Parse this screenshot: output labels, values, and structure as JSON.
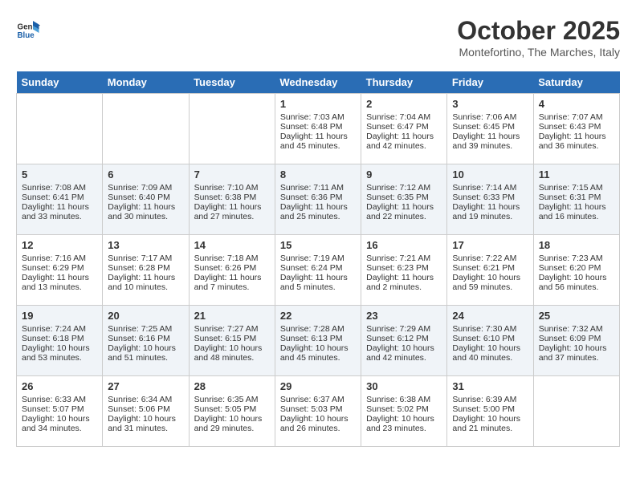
{
  "header": {
    "logo_line1": "General",
    "logo_line2": "Blue",
    "month": "October 2025",
    "location": "Montefortino, The Marches, Italy"
  },
  "days_of_week": [
    "Sunday",
    "Monday",
    "Tuesday",
    "Wednesday",
    "Thursday",
    "Friday",
    "Saturday"
  ],
  "weeks": [
    [
      {
        "day": "",
        "content": ""
      },
      {
        "day": "",
        "content": ""
      },
      {
        "day": "",
        "content": ""
      },
      {
        "day": "1",
        "content": "Sunrise: 7:03 AM\nSunset: 6:48 PM\nDaylight: 11 hours\nand 45 minutes."
      },
      {
        "day": "2",
        "content": "Sunrise: 7:04 AM\nSunset: 6:47 PM\nDaylight: 11 hours\nand 42 minutes."
      },
      {
        "day": "3",
        "content": "Sunrise: 7:06 AM\nSunset: 6:45 PM\nDaylight: 11 hours\nand 39 minutes."
      },
      {
        "day": "4",
        "content": "Sunrise: 7:07 AM\nSunset: 6:43 PM\nDaylight: 11 hours\nand 36 minutes."
      }
    ],
    [
      {
        "day": "5",
        "content": "Sunrise: 7:08 AM\nSunset: 6:41 PM\nDaylight: 11 hours\nand 33 minutes."
      },
      {
        "day": "6",
        "content": "Sunrise: 7:09 AM\nSunset: 6:40 PM\nDaylight: 11 hours\nand 30 minutes."
      },
      {
        "day": "7",
        "content": "Sunrise: 7:10 AM\nSunset: 6:38 PM\nDaylight: 11 hours\nand 27 minutes."
      },
      {
        "day": "8",
        "content": "Sunrise: 7:11 AM\nSunset: 6:36 PM\nDaylight: 11 hours\nand 25 minutes."
      },
      {
        "day": "9",
        "content": "Sunrise: 7:12 AM\nSunset: 6:35 PM\nDaylight: 11 hours\nand 22 minutes."
      },
      {
        "day": "10",
        "content": "Sunrise: 7:14 AM\nSunset: 6:33 PM\nDaylight: 11 hours\nand 19 minutes."
      },
      {
        "day": "11",
        "content": "Sunrise: 7:15 AM\nSunset: 6:31 PM\nDaylight: 11 hours\nand 16 minutes."
      }
    ],
    [
      {
        "day": "12",
        "content": "Sunrise: 7:16 AM\nSunset: 6:29 PM\nDaylight: 11 hours\nand 13 minutes."
      },
      {
        "day": "13",
        "content": "Sunrise: 7:17 AM\nSunset: 6:28 PM\nDaylight: 11 hours\nand 10 minutes."
      },
      {
        "day": "14",
        "content": "Sunrise: 7:18 AM\nSunset: 6:26 PM\nDaylight: 11 hours\nand 7 minutes."
      },
      {
        "day": "15",
        "content": "Sunrise: 7:19 AM\nSunset: 6:24 PM\nDaylight: 11 hours\nand 5 minutes."
      },
      {
        "day": "16",
        "content": "Sunrise: 7:21 AM\nSunset: 6:23 PM\nDaylight: 11 hours\nand 2 minutes."
      },
      {
        "day": "17",
        "content": "Sunrise: 7:22 AM\nSunset: 6:21 PM\nDaylight: 10 hours\nand 59 minutes."
      },
      {
        "day": "18",
        "content": "Sunrise: 7:23 AM\nSunset: 6:20 PM\nDaylight: 10 hours\nand 56 minutes."
      }
    ],
    [
      {
        "day": "19",
        "content": "Sunrise: 7:24 AM\nSunset: 6:18 PM\nDaylight: 10 hours\nand 53 minutes."
      },
      {
        "day": "20",
        "content": "Sunrise: 7:25 AM\nSunset: 6:16 PM\nDaylight: 10 hours\nand 51 minutes."
      },
      {
        "day": "21",
        "content": "Sunrise: 7:27 AM\nSunset: 6:15 PM\nDaylight: 10 hours\nand 48 minutes."
      },
      {
        "day": "22",
        "content": "Sunrise: 7:28 AM\nSunset: 6:13 PM\nDaylight: 10 hours\nand 45 minutes."
      },
      {
        "day": "23",
        "content": "Sunrise: 7:29 AM\nSunset: 6:12 PM\nDaylight: 10 hours\nand 42 minutes."
      },
      {
        "day": "24",
        "content": "Sunrise: 7:30 AM\nSunset: 6:10 PM\nDaylight: 10 hours\nand 40 minutes."
      },
      {
        "day": "25",
        "content": "Sunrise: 7:32 AM\nSunset: 6:09 PM\nDaylight: 10 hours\nand 37 minutes."
      }
    ],
    [
      {
        "day": "26",
        "content": "Sunrise: 6:33 AM\nSunset: 5:07 PM\nDaylight: 10 hours\nand 34 minutes."
      },
      {
        "day": "27",
        "content": "Sunrise: 6:34 AM\nSunset: 5:06 PM\nDaylight: 10 hours\nand 31 minutes."
      },
      {
        "day": "28",
        "content": "Sunrise: 6:35 AM\nSunset: 5:05 PM\nDaylight: 10 hours\nand 29 minutes."
      },
      {
        "day": "29",
        "content": "Sunrise: 6:37 AM\nSunset: 5:03 PM\nDaylight: 10 hours\nand 26 minutes."
      },
      {
        "day": "30",
        "content": "Sunrise: 6:38 AM\nSunset: 5:02 PM\nDaylight: 10 hours\nand 23 minutes."
      },
      {
        "day": "31",
        "content": "Sunrise: 6:39 AM\nSunset: 5:00 PM\nDaylight: 10 hours\nand 21 minutes."
      },
      {
        "day": "",
        "content": ""
      }
    ]
  ]
}
